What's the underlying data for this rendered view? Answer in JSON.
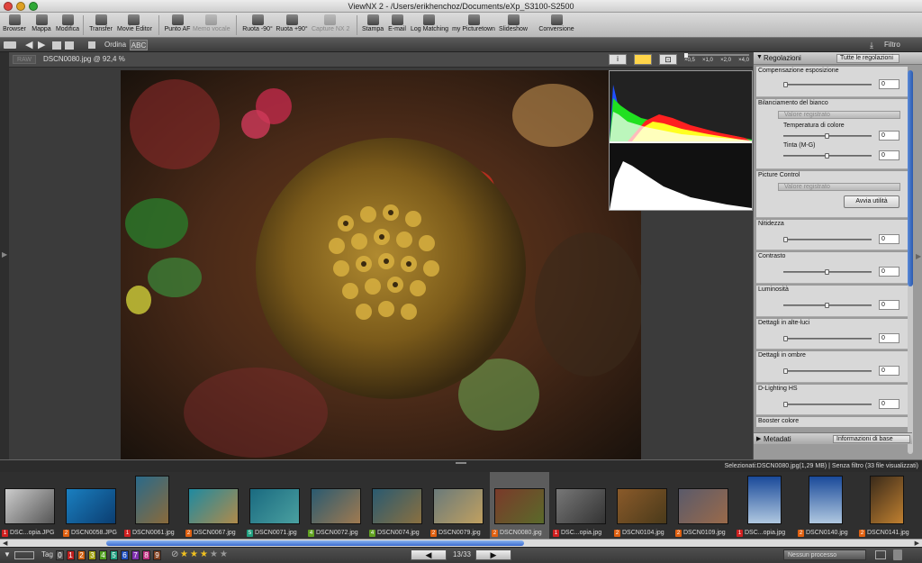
{
  "window": {
    "title": "ViewNX 2 - /Users/erikhenchoz/Documents/eXp_S3100-S2500"
  },
  "toolbar": {
    "items": [
      {
        "label": "Browser",
        "icon": "browser-icon",
        "enabled": true
      },
      {
        "label": "Mappa",
        "icon": "map-icon",
        "enabled": true
      },
      {
        "label": "Modifica",
        "icon": "edit-icon",
        "enabled": true
      },
      {
        "label": "Transfer",
        "icon": "transfer-icon",
        "enabled": true
      },
      {
        "label": "Movie Editor",
        "icon": "movie-editor-icon",
        "enabled": true
      },
      {
        "label": "Punto AF",
        "icon": "af-point-icon",
        "enabled": true
      },
      {
        "label": "Memo vocale",
        "icon": "voice-memo-icon",
        "enabled": false
      },
      {
        "label": "Ruota -90°",
        "icon": "rotate-left-icon",
        "enabled": true
      },
      {
        "label": "Ruota +90°",
        "icon": "rotate-right-icon",
        "enabled": true
      },
      {
        "label": "Capture NX 2",
        "icon": "capture-nx-icon",
        "enabled": false
      },
      {
        "label": "Stampa",
        "icon": "print-icon",
        "enabled": true
      },
      {
        "label": "E-mail",
        "icon": "email-icon",
        "enabled": true
      },
      {
        "label": "Log Matching",
        "icon": "log-matching-icon",
        "enabled": true
      },
      {
        "label": "my Picturetown",
        "icon": "picturetown-icon",
        "enabled": true
      },
      {
        "label": "Slideshow",
        "icon": "slideshow-icon",
        "enabled": true
      },
      {
        "label": "Conversione",
        "icon": "conversion-icon",
        "enabled": true
      }
    ]
  },
  "subbar": {
    "sort_label": "Ordina",
    "filter_label": "Filtro"
  },
  "viewer": {
    "file_label": "DSCN0080.jpg @ 92,4 %",
    "zoom_ticks": [
      "×0,5",
      "×1,0",
      "×2,0",
      "×4,0"
    ]
  },
  "panel": {
    "header": "Regolazioni",
    "preset": "Tutte le regolazioni",
    "sections": [
      {
        "label": "Compensazione esposizione",
        "value": "0"
      },
      {
        "label": "Bilanciamento del bianco",
        "select": "Valore registrato",
        "sub": [
          {
            "label": "Temperatura di colore",
            "value": "0"
          },
          {
            "label": "Tinta (M-G)",
            "value": "0"
          }
        ]
      },
      {
        "label": "Picture Control",
        "select": "Valore registrato",
        "button": "Avvia utilità"
      },
      {
        "label": "Nitidezza",
        "value": "0"
      },
      {
        "label": "Contrasto",
        "value": "0"
      },
      {
        "label": "Luminosità",
        "value": "0"
      },
      {
        "label": "Dettagli in alte-luci",
        "value": "0"
      },
      {
        "label": "Dettagli in ombre",
        "value": "0"
      },
      {
        "label": "D-Lighting HS",
        "value": "0"
      },
      {
        "label": "Booster colore"
      }
    ],
    "metadata_label": "Metadati",
    "metadata_preset": "Informazioni di base"
  },
  "filmstrip": {
    "selection_info": "Selezionati:DSCN0080.jpg(1,29 MB) | Senza filtro (33 file visualizzati)",
    "items": [
      {
        "name": "DSC...opia.JPG",
        "badge": "1",
        "badge_color": "#d02020",
        "tone": "linear-gradient(135deg,#ccc,#555)"
      },
      {
        "name": "DSCN0058.JPG",
        "badge": "2",
        "badge_color": "#e06010",
        "tone": "linear-gradient(135deg,#1a7fc0,#0b3d70)"
      },
      {
        "name": "DSCN0061.jpg",
        "badge": "1",
        "badge_color": "#d02020",
        "tone": "linear-gradient(135deg,#2a6a8a,#8a6a3a)"
      },
      {
        "name": "DSCN0067.jpg",
        "badge": "2",
        "badge_color": "#e06010",
        "tone": "linear-gradient(135deg,#1f8aa0,#b08a4a)"
      },
      {
        "name": "DSCN0071.jpg",
        "badge": "5",
        "badge_color": "#20a080",
        "tone": "linear-gradient(135deg,#1a6a80,#4aa0a0)"
      },
      {
        "name": "DSCN0072.jpg",
        "badge": "4",
        "badge_color": "#60a020",
        "tone": "linear-gradient(135deg,#2a5a70,#a07a50)"
      },
      {
        "name": "DSCN0074.jpg",
        "badge": "4",
        "badge_color": "#60a020",
        "tone": "linear-gradient(135deg,#2a5a70,#8a7040)"
      },
      {
        "name": "DSCN0079.jpg",
        "badge": "2",
        "badge_color": "#e06010",
        "tone": "linear-gradient(135deg,#6a7a7a,#c0a060)"
      },
      {
        "name": "DSCN0080.jpg",
        "badge": "2",
        "badge_color": "#e06010",
        "tone": "linear-gradient(135deg,#7a3a2a,#5a6a2a)",
        "selected": true
      },
      {
        "name": "DSC...opia.jpg",
        "badge": "1",
        "badge_color": "#d02020",
        "tone": "linear-gradient(135deg,#777,#333)"
      },
      {
        "name": "DSCN0104.jpg",
        "badge": "2",
        "badge_color": "#e06010",
        "tone": "linear-gradient(135deg,#8a5a2a,#4a3a1a)"
      },
      {
        "name": "DSCN0109.jpg",
        "badge": "2",
        "badge_color": "#e06010",
        "tone": "linear-gradient(135deg,#5a5a6a,#9a6a4a)"
      },
      {
        "name": "DSC...opia.jpg",
        "badge": "1",
        "badge_color": "#d02020",
        "tone": "linear-gradient(180deg,#1a4a9a,#b0c8e0)"
      },
      {
        "name": "DSCN0140.jpg",
        "badge": "2",
        "badge_color": "#e06010",
        "tone": "linear-gradient(180deg,#1a4a9a,#b0c8e0)"
      },
      {
        "name": "DSCN0141.jpg",
        "badge": "2",
        "badge_color": "#e06010",
        "tone": "linear-gradient(135deg,#3a2a1a,#c08030)"
      }
    ]
  },
  "statusbar": {
    "tag_label": "Tag",
    "tags": [
      {
        "n": "0",
        "c": "#555"
      },
      {
        "n": "1",
        "c": "#c02020"
      },
      {
        "n": "2",
        "c": "#d06010"
      },
      {
        "n": "3",
        "c": "#a0a010"
      },
      {
        "n": "4",
        "c": "#50a020"
      },
      {
        "n": "5",
        "c": "#20a080"
      },
      {
        "n": "6",
        "c": "#2050c0"
      },
      {
        "n": "7",
        "c": "#8030b0"
      },
      {
        "n": "8",
        "c": "#c03080"
      },
      {
        "n": "9",
        "c": "#804020"
      }
    ],
    "rating": 3,
    "page": "13/33",
    "process": "Nessun processo"
  }
}
